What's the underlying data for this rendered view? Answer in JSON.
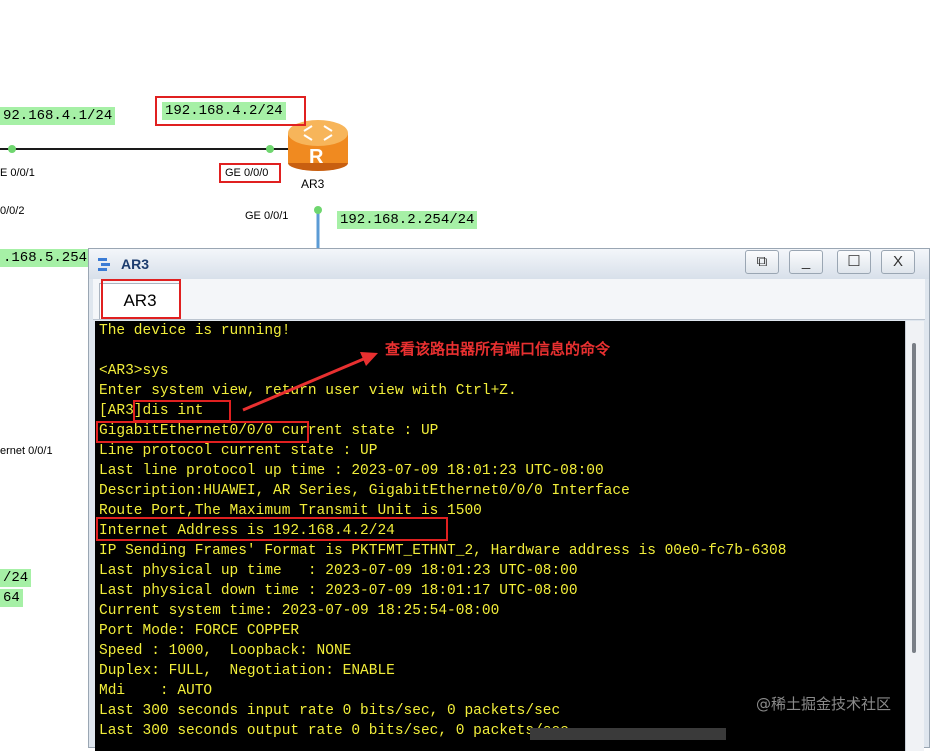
{
  "topology": {
    "ip_labels": {
      "ar_left_ge001": "92.168.4.1/24",
      "ar3_ge000": "192.168.4.2/24",
      "ar3_ge001": "192.168.2.254/24",
      "left_partial_1": ".168.5.254",
      "left_partial_2": "/24",
      "left_partial_3": "64"
    },
    "port_labels": {
      "left_ge001": "E 0/0/1",
      "left_ge002": "0/0/2",
      "ar3_ge000": "GE 0/0/0",
      "ar3_ge001": "GE 0/0/1",
      "left_ethernet": "ernet 0/0/1"
    },
    "router_name": "AR3",
    "router_glyph": "R"
  },
  "window": {
    "title": "AR3",
    "tab_label": "AR3",
    "controls": {
      "restore": "⧉",
      "minimize": "_",
      "maximize": "☐",
      "close": "X"
    }
  },
  "terminal": {
    "lines": [
      "The device is running!",
      "",
      "<AR3>sys",
      "Enter system view, return user view with Ctrl+Z.",
      "[AR3]dis int",
      "GigabitEthernet0/0/0 current state : UP",
      "Line protocol current state : UP",
      "Last line protocol up time : 2023-07-09 18:01:23 UTC-08:00",
      "Description:HUAWEI, AR Series, GigabitEthernet0/0/0 Interface",
      "Route Port,The Maximum Transmit Unit is 1500",
      "Internet Address is 192.168.4.2/24",
      "IP Sending Frames' Format is PKTFMT_ETHNT_2, Hardware address is 00e0-fc7b-6308",
      "Last physical up time   : 2023-07-09 18:01:23 UTC-08:00",
      "Last physical down time : 2023-07-09 18:01:17 UTC-08:00",
      "Current system time: 2023-07-09 18:25:54-08:00",
      "Port Mode: FORCE COPPER",
      "Speed : 1000,  Loopback: NONE",
      "Duplex: FULL,  Negotiation: ENABLE",
      "Mdi    : AUTO",
      "Last 300 seconds input rate 0 bits/sec, 0 packets/sec",
      "Last 300 seconds output rate 0 bits/sec, 0 packets/sec"
    ]
  },
  "annotation": {
    "text": "查看该路由器所有端口信息的命令",
    "color": "#e83030"
  },
  "watermark": "@稀土掘金技术社区",
  "colors": {
    "terminal_text": "#f2ee3a",
    "ip_label_bg": "#a6f0a6",
    "highlight_box": "#e02020",
    "link_line": "#1a1a1a",
    "link_line_vertical": "#5b9bd5"
  }
}
